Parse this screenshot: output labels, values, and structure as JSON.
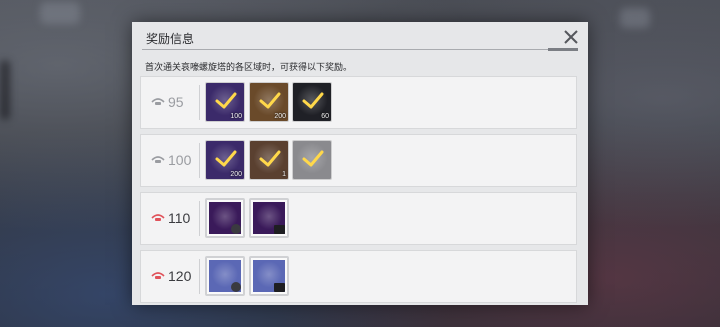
{
  "dialog": {
    "title": "奖励信息",
    "subtitle": "首次通关哀嚎螺旋塔的各区域时，可获得以下奖励。"
  },
  "tiers": [
    {
      "level": "95",
      "level_color": "#9a9ca1",
      "icon_color": "#9a9ca1",
      "items": [
        {
          "name": "purple-crystal-reward",
          "qty": "100",
          "claimed": true,
          "bg": "#3b2a6a"
        },
        {
          "name": "bronze-emblem-reward",
          "qty": "200",
          "claimed": true,
          "bg": "#6a4a2a"
        },
        {
          "name": "blue-shard-reward",
          "qty": "60",
          "claimed": true,
          "bg": "#1f2026"
        }
      ]
    },
    {
      "level": "100",
      "level_color": "#9a9ca1",
      "icon_color": "#9a9ca1",
      "items": [
        {
          "name": "purple-crystal-reward",
          "qty": "200",
          "claimed": true,
          "bg": "#3b2a6a"
        },
        {
          "name": "teal-cube-reward",
          "qty": "1",
          "claimed": true,
          "bg": "#5a4030"
        },
        {
          "name": "gray-core-reward",
          "qty": "",
          "claimed": true,
          "bg": "#8a8a8e"
        }
      ]
    },
    {
      "level": "110",
      "level_color": "#3a3b3f",
      "icon_color": "#e0525a",
      "items": [
        {
          "name": "dark-purple-crate-reward",
          "qty": "",
          "claimed": false,
          "bg": "#3a1a5a",
          "tag": "circle"
        },
        {
          "name": "dark-purple-card-reward",
          "qty": "",
          "claimed": false,
          "bg": "#3a1a5a",
          "tag": "card"
        }
      ]
    },
    {
      "level": "120",
      "level_color": "#3a3b3f",
      "icon_color": "#e0525a",
      "items": [
        {
          "name": "lavender-crate-reward",
          "qty": "",
          "claimed": false,
          "bg": "#5b68b5",
          "tag": "circle"
        },
        {
          "name": "lavender-card-reward",
          "qty": "",
          "claimed": false,
          "bg": "#5b68b5",
          "tag": "card"
        }
      ]
    }
  ]
}
